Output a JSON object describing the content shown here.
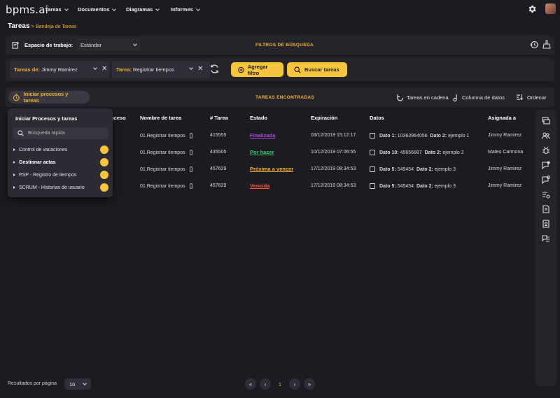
{
  "topbar": {
    "logo": "bpms.ai",
    "nav": [
      "Tareas",
      "Documentos",
      "Diagramas",
      "Informes"
    ]
  },
  "breadcrumb": {
    "title": "Tareas",
    "separator": ">",
    "sub": "Bandeja de Tareas"
  },
  "workspace": {
    "label": "Espacio de trabajo:",
    "value": "Estándar",
    "section_title": "FILTROS DE BÚSQUEDA"
  },
  "filters": {
    "chips": [
      {
        "key": "Tareas de:",
        "value": "Jimmy Ramirez"
      },
      {
        "key": "Tarea:",
        "value": "Registrar tiempos"
      }
    ],
    "add_filter": "Agregar filtro",
    "search_button": "Buscar tareas"
  },
  "tasks_bar": {
    "start_button": "Iniciar procesos y tareas",
    "section_title": "TAREAS ENCONTRADAS",
    "tools": [
      "Tareas en cadena",
      "Columna de datos",
      "Ordenar"
    ]
  },
  "table": {
    "headers": [
      "oceso",
      "Nombre de tarea",
      "# Tarea",
      "Estado",
      "Expiración",
      "Datos",
      "Asignada a"
    ],
    "rows": [
      {
        "name": "01.Registrar tiempos",
        "num": "415555",
        "state": "Finalizada",
        "state_color": "#a64dd6",
        "exp": "03/12/2019 15:12:17",
        "d1k": "Dato 1:",
        "d1v": "10363964056",
        "d2k": "Dato 2:",
        "d2v": "ejemplo 1",
        "assigned": "Jimmy Ramirez"
      },
      {
        "name": "01.Registrar tiempos",
        "num": "435505",
        "state": "Por hacer",
        "state_color": "#2ecc71",
        "exp": "10/12/2019 07:06:55",
        "d1k": "Dato 10:",
        "d1v": "45656687",
        "d2k": "Dato 2:",
        "d2v": "ejemplo 2",
        "assigned": "Mateo Carmona"
      },
      {
        "name": "01.Registrar tiempos",
        "num": "457629",
        "state": "Próxima a vencer",
        "state_color": "#f3b32b",
        "exp": "17/12/2019 08:34:53",
        "d1k": "Dato 5:",
        "d1v": "545454",
        "d2k": "Dato 2:",
        "d2v": "ejemplo 3",
        "assigned": "Jimmy Ramirez"
      },
      {
        "name": "01.Registrar tiempos",
        "num": "457629",
        "state": "Vencida",
        "state_color": "#ff5a36",
        "exp": "17/12/2019 08:34:53",
        "d1k": "Dato 5:",
        "d1v": "545454",
        "d2k": "Dato 2:",
        "d2v": "ejemplo 3",
        "assigned": "Jimmy Ramirez"
      }
    ]
  },
  "dropdown": {
    "title": "Iniciar Procesos y tareas",
    "search_placeholder": "Búsqueda rápida",
    "items": [
      "Control de vacaciones",
      "Gestionar actas",
      "PSP - Registro de tiempos",
      "SCRUM - Historias de usuario"
    ]
  },
  "footer": {
    "per_page_label": "Resultados por página",
    "per_page_value": "10",
    "current_page": "1"
  },
  "colors": {
    "accent": "#f7c53b",
    "bg": "#1c1b22",
    "panel": "#25242b"
  }
}
